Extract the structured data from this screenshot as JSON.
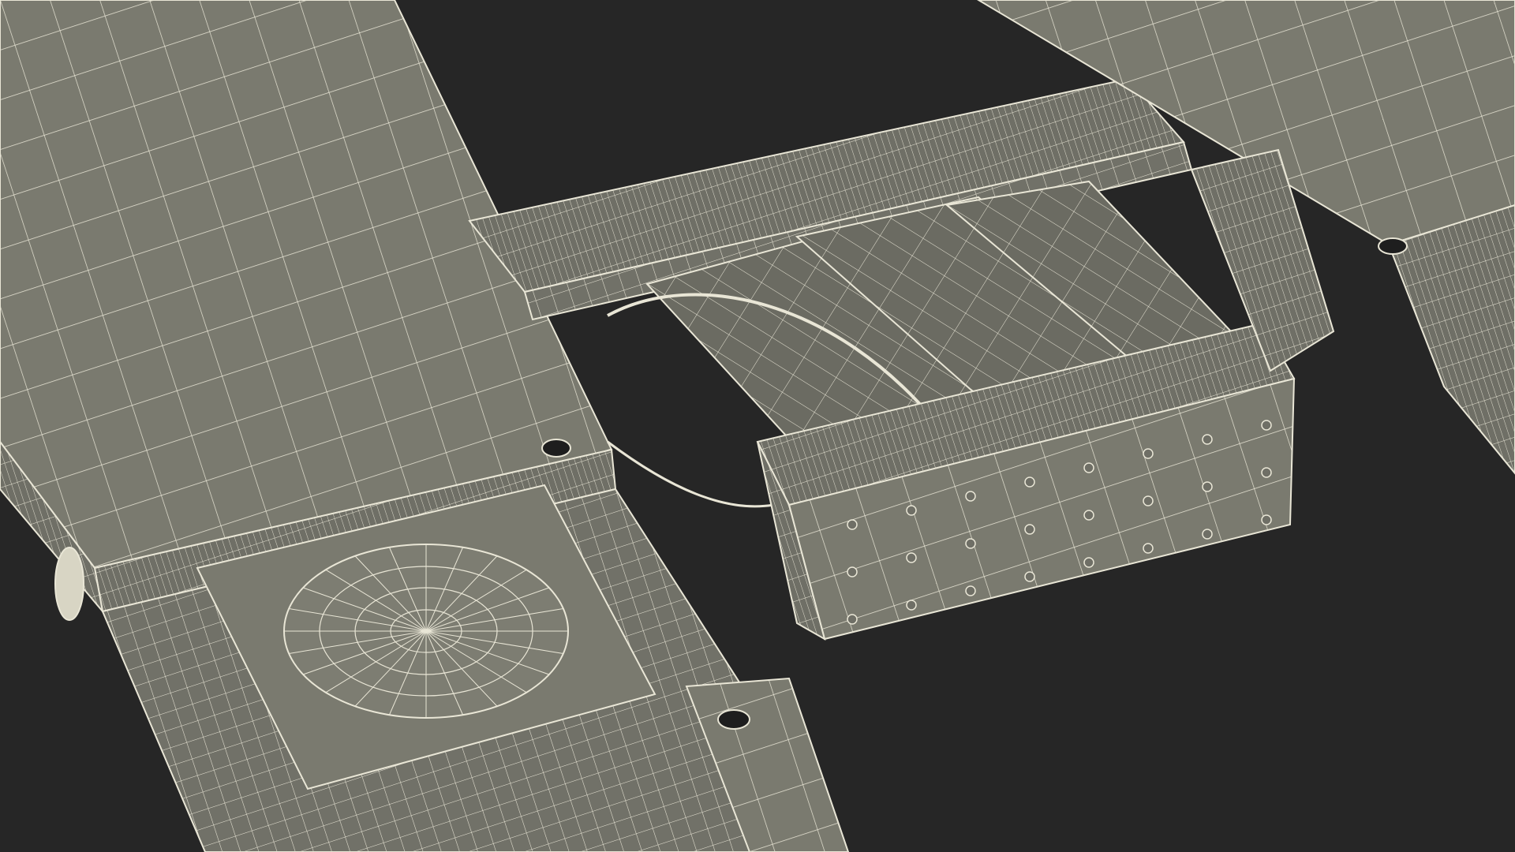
{
  "scene": {
    "background_color": "#262626",
    "surface_color": "#7a7a6f",
    "surface_shadow_color": "#5f5f56",
    "wire_color": "#e9e6d6",
    "objects": [
      "left-runway-platform",
      "turntable-plate",
      "crossbeam-rear",
      "cylinder-assembly",
      "crossbeam-front",
      "right-runway-platform"
    ]
  }
}
